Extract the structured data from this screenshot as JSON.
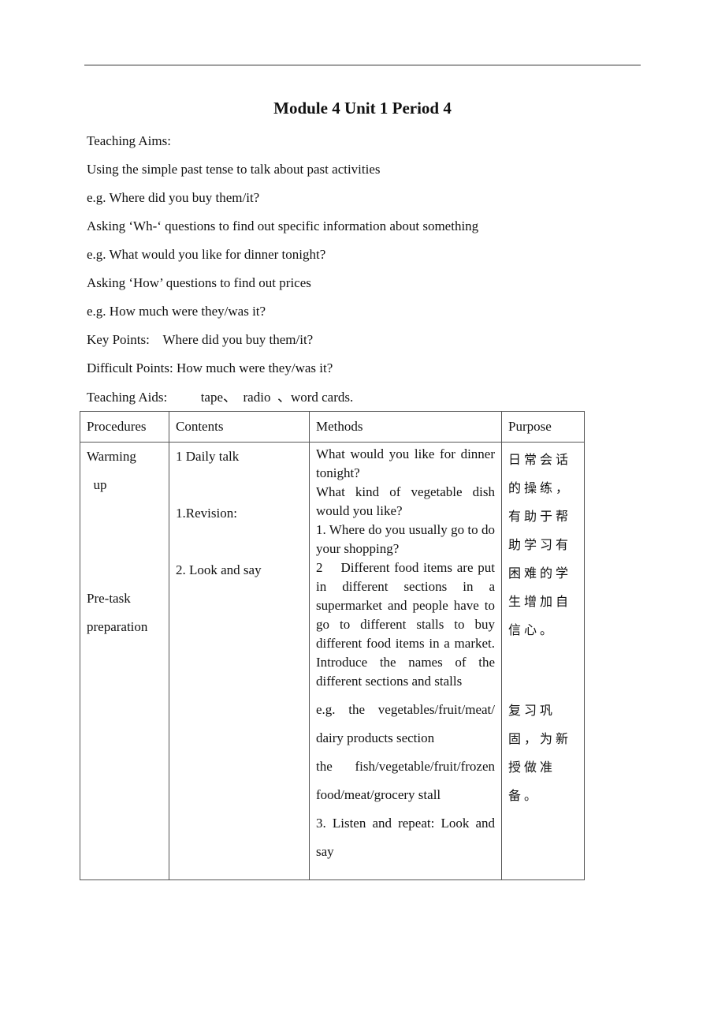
{
  "title": "Module 4 Unit 1 Period 4",
  "intro": {
    "teaching_aims_label": "Teaching Aims:",
    "lines": [
      "Using the simple past tense to talk about past activities",
      "e.g. Where did you buy them/it?",
      "Asking ‘Wh-‘ questions to find out specific information about something",
      "e.g. What would you like for dinner tonight?",
      "Asking ‘How’ questions to find out prices",
      "e.g. How much were they/was it?"
    ],
    "key_points": "Key Points:    Where did you buy them/it?",
    "difficult_points": "Difficult Points: How much were they/was it?",
    "teaching_aids": "Teaching Aids:          tape、  radio  、word cards."
  },
  "table": {
    "headers": [
      "Procedures",
      "Contents",
      "Methods",
      "Purpose"
    ],
    "procedures": [
      "Warming",
      "  up",
      "Pre-task",
      "preparation"
    ],
    "contents": [
      "1 Daily talk",
      "1.Revision:",
      "2. Look and say"
    ],
    "methods_block1": [
      "What would you like for dinner tonight?",
      "What kind of vegetable dish would you like?",
      "1. Where do you usually go to do your shopping?",
      "2    Different food items are put in different sections in a supermarket and people have to go to different stalls to buy different food items in a market. Introduce the names of the different sections and stalls"
    ],
    "methods_block2": [
      "e.g. the vegetables/fruit/meat/ dairy products section",
      "the fish/vegetable/fruit/frozen food/meat/grocery stall",
      "3. Listen and repeat: Look and say"
    ],
    "purpose1": "日常会话的操练，有助于帮助学习有困难的学生增加自信心。",
    "purpose2": "复习巩固，为新授做准备。"
  }
}
